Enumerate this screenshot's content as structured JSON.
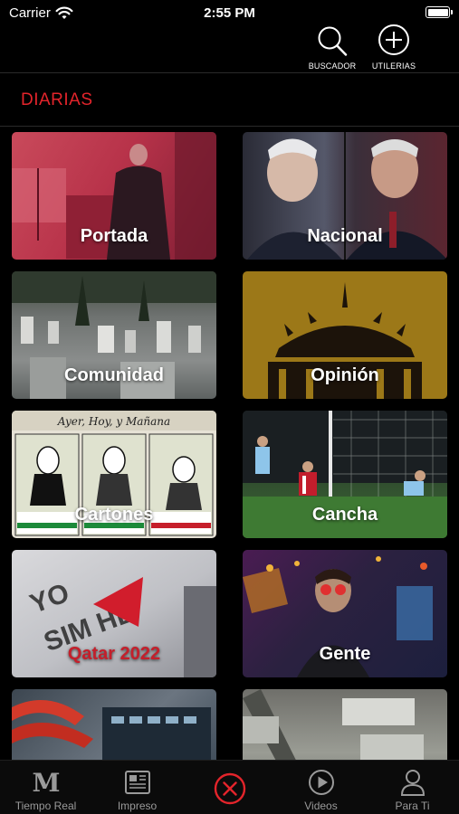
{
  "status_bar": {
    "carrier": "Carrier",
    "time": "2:55 PM"
  },
  "top_actions": {
    "search_label": "BUSCADOR",
    "utilities_label": "UTILERIAS"
  },
  "section": {
    "title": "DIARIAS"
  },
  "cards": [
    {
      "label": "Portada"
    },
    {
      "label": "Nacional"
    },
    {
      "label": "Comunidad"
    },
    {
      "label": "Opinión"
    },
    {
      "label": "Cartones",
      "art_text": "Ayer, Hoy, y Mañana"
    },
    {
      "label": "Cancha"
    },
    {
      "label": "Qatar 2022"
    },
    {
      "label": "Gente"
    },
    {
      "label": ""
    },
    {
      "label": ""
    }
  ],
  "tabbar": {
    "tabs": [
      {
        "label": "Tiempo Real",
        "icon": "m-logo-icon"
      },
      {
        "label": "Impreso",
        "icon": "newspaper-icon"
      },
      {
        "label": "",
        "icon": "close-circle-icon"
      },
      {
        "label": "Videos",
        "icon": "play-circle-icon"
      },
      {
        "label": "Para Ti",
        "icon": "user-icon"
      }
    ]
  },
  "colors": {
    "accent": "#e3242b",
    "background": "#000000"
  }
}
